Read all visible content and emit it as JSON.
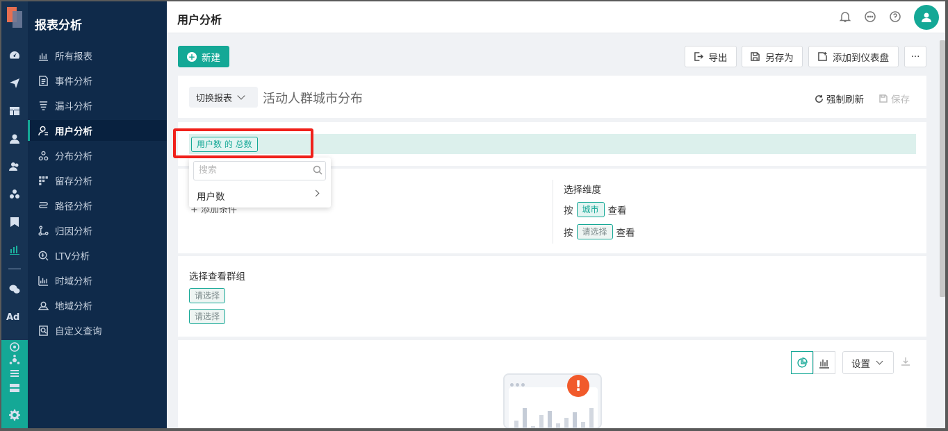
{
  "app": {
    "section_title": "报表分析",
    "page_title": "用户分析"
  },
  "sidebar": {
    "items": [
      {
        "label": "所有报表",
        "icon": "bar-chart-icon"
      },
      {
        "label": "事件分析",
        "icon": "event-icon"
      },
      {
        "label": "漏斗分析",
        "icon": "funnel-icon"
      },
      {
        "label": "用户分析",
        "icon": "user-icon",
        "active": true
      },
      {
        "label": "分布分析",
        "icon": "distribution-icon"
      },
      {
        "label": "留存分析",
        "icon": "retention-icon"
      },
      {
        "label": "路径分析",
        "icon": "path-icon"
      },
      {
        "label": "归因分析",
        "icon": "attribution-icon"
      },
      {
        "label": "LTV分析",
        "icon": "ltv-icon"
      },
      {
        "label": "时域分析",
        "icon": "time-chart-icon"
      },
      {
        "label": "地域分析",
        "icon": "map-icon"
      },
      {
        "label": "自定义查询",
        "icon": "query-icon"
      }
    ]
  },
  "rail": {
    "ad_label": "Ad"
  },
  "toolbar": {
    "new_label": "新建",
    "export_label": "导出",
    "save_as_label": "另存为",
    "add_dashboard_label": "添加到仪表盘",
    "more_label": "···"
  },
  "report": {
    "switch_label": "切换报表",
    "name": "活动人群城市分布",
    "refresh_label": "强制刷新",
    "save_label": "保存"
  },
  "metric": {
    "tag": "用户数 的 总数"
  },
  "dropdown": {
    "search_placeholder": "搜索",
    "items": [
      "用户数"
    ]
  },
  "conditions": {
    "add_label": "+ 添加条件"
  },
  "dimensions": {
    "title": "选择维度",
    "prefix": "按",
    "suffix": "查看",
    "rows": [
      "城市",
      "请选择"
    ]
  },
  "group": {
    "title": "选择查看群组",
    "tags": [
      "请选择",
      "请选择"
    ]
  },
  "chart_panel": {
    "settings_label": "设置"
  },
  "colors": {
    "accent": "#14a896",
    "sidebar_bg": "#0f2a4a",
    "highlight": "#f0211b"
  }
}
